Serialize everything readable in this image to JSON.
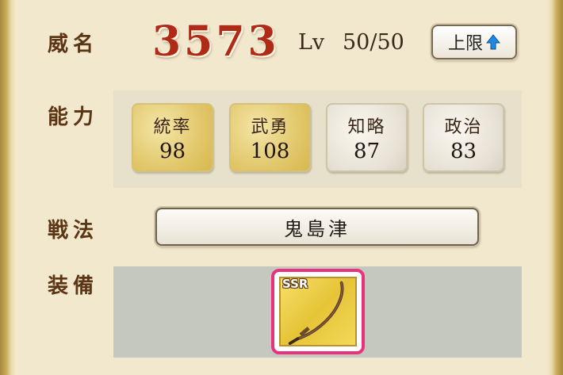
{
  "labels": {
    "prestige": "威名",
    "ability": "能力",
    "tactic": "戦法",
    "equipment": "装備"
  },
  "prestige_value": "3573",
  "level": {
    "label": "Lv",
    "value": "50/50"
  },
  "limit_button": {
    "label": "上限",
    "icon": "up-arrow-icon"
  },
  "stats": [
    {
      "name": "統率",
      "value": "98",
      "style": "gold"
    },
    {
      "name": "武勇",
      "value": "108",
      "style": "gold"
    },
    {
      "name": "知略",
      "value": "87",
      "style": "silver"
    },
    {
      "name": "政治",
      "value": "83",
      "style": "silver"
    }
  ],
  "tactic": {
    "name": "鬼島津"
  },
  "equipment": {
    "rarity": "SSR",
    "icon": "katana-icon"
  },
  "colors": {
    "prestige": "#b02a18",
    "highlight_border": "#e8327a",
    "up_arrow": "#1e88e5"
  }
}
